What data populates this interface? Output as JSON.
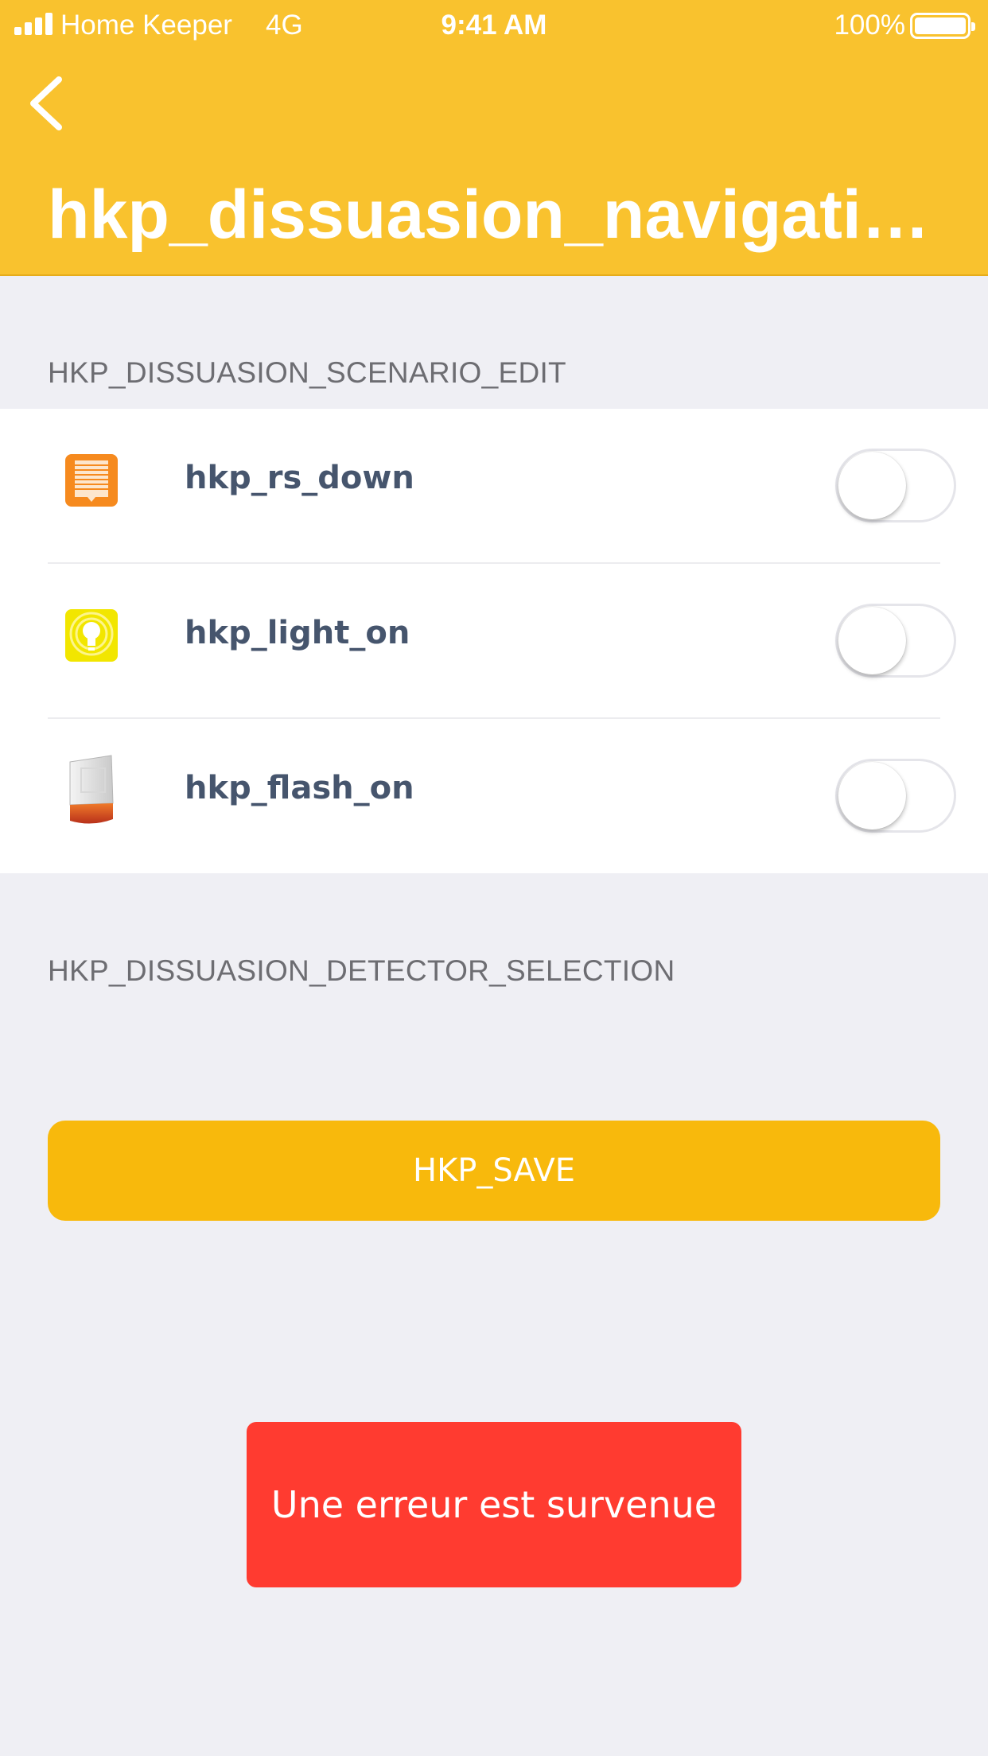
{
  "status_bar": {
    "carrier": "Home Keeper",
    "network": "4G",
    "time": "9:41 AM",
    "battery": "100%"
  },
  "nav": {
    "back_icon": "chevron-left-icon",
    "title": "hkp_dissuasion_navigatio..."
  },
  "scenario_section": {
    "header": "HKP_DISSUASION_SCENARIO_EDIT",
    "items": [
      {
        "label": "hkp_rs_down",
        "icon": "roller-shutter-icon",
        "enabled": false
      },
      {
        "label": "hkp_light_on",
        "icon": "light-bulb-icon",
        "enabled": false
      },
      {
        "label": "hkp_flash_on",
        "icon": "siren-icon",
        "enabled": false
      }
    ]
  },
  "detector_section": {
    "header": "HKP_DISSUASION_DETECTOR_SELECTION"
  },
  "save_button": {
    "label": "HKP_SAVE"
  },
  "error_toast": {
    "message": "Une erreur est survenue"
  },
  "colors": {
    "header_bg": "#f9c22e",
    "save_button": "#f8b90c",
    "error_toast": "#ff3b30",
    "background": "#efeff4"
  }
}
